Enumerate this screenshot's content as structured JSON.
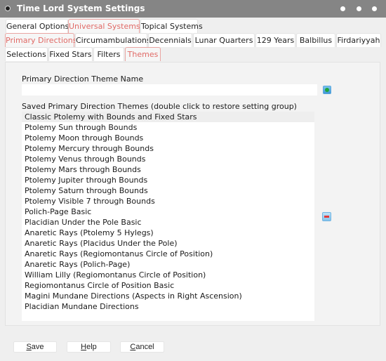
{
  "window": {
    "title": "Time Lord System Settings",
    "controls": [
      "menu-dot",
      "menu-dot",
      "menu-dot"
    ]
  },
  "tabs_level1": [
    {
      "label": "General Options",
      "active": false
    },
    {
      "label": "Universal Systems",
      "active": true
    },
    {
      "label": "Topical Systems",
      "active": false
    }
  ],
  "tabs_level2": [
    {
      "label": "Primary Directions",
      "active": true
    },
    {
      "label": "Circumambulations",
      "active": false
    },
    {
      "label": "Decennials",
      "active": false
    },
    {
      "label": "Lunar Quarters",
      "active": false
    },
    {
      "label": "129 Years",
      "active": false
    },
    {
      "label": "Balbillus",
      "active": false
    },
    {
      "label": "Firdariyyah",
      "active": false
    }
  ],
  "tabs_level3": [
    {
      "label": "Selections",
      "active": false
    },
    {
      "label": "Fixed Stars",
      "active": false
    },
    {
      "label": "Filters",
      "active": false
    },
    {
      "label": "Themes",
      "active": true
    }
  ],
  "themes": {
    "name_label": "Primary Direction Theme Name",
    "name_value": "",
    "add_icon": "add-icon",
    "saved_label": "Saved Primary Direction Themes (double click to restore setting group)",
    "remove_icon": "remove-icon",
    "selected_index": 0,
    "items": [
      "Classic Ptolemy with Bounds and Fixed Stars",
      "Ptolemy Sun through Bounds",
      "Ptolemy Moon through Bounds",
      "Ptolemy Mercury through Bounds",
      "Ptolemy Venus through Bounds",
      "Ptolemy Mars through Bounds",
      "Ptolemy Jupiter through Bounds",
      "Ptolemy Saturn through Bounds",
      "Ptolemy Visible 7 through Bounds",
      "Polich-Page Basic",
      "Placidian Under the Pole Basic",
      "Anaretic Rays (Ptolemy 5 Hylegs)",
      "Anaretic Rays (Placidus Under the Pole)",
      "Anaretic Rays (Regiomontanus Circle of Position)",
      "Anaretic Rays (Polich-Page)",
      "William Lilly (Regiomontanus Circle of Position)",
      "Regiomontanus Circle of Position Basic",
      "Magini Mundane Directions (Aspects in Right Ascension)",
      "Placidian Mundane Directions"
    ]
  },
  "buttons": {
    "save": {
      "mnemonic": "S",
      "rest": "ave"
    },
    "help": {
      "mnemonic": "H",
      "rest": "elp"
    },
    "cancel": {
      "mnemonic": "C",
      "rest": "ancel"
    }
  },
  "colors": {
    "titlebar": "#858585",
    "active_tab_text": "#e06a66",
    "active_tab_border": "#eaa5a2",
    "add_icon_green": "#1fa63c",
    "remove_icon_red": "#e23a3a"
  }
}
